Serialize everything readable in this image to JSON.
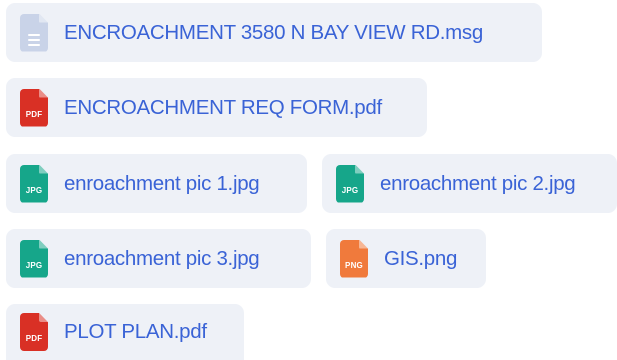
{
  "attachments": [
    {
      "name": "ENCROACHMENT 3580 N BAY VIEW RD.msg",
      "type_label": "",
      "icon": "document-icon",
      "color": "#c9d3e8"
    },
    {
      "name": "ENCROACHMENT REQ FORM.pdf",
      "type_label": "PDF",
      "icon": "pdf-file-icon",
      "color": "#d93025"
    },
    {
      "name": "enroachment pic 1.jpg",
      "type_label": "JPG",
      "icon": "jpg-file-icon",
      "color": "#16a68a"
    },
    {
      "name": "enroachment pic 2.jpg",
      "type_label": "JPG",
      "icon": "jpg-file-icon",
      "color": "#16a68a"
    },
    {
      "name": "enroachment pic 3.jpg",
      "type_label": "JPG",
      "icon": "jpg-file-icon",
      "color": "#16a68a"
    },
    {
      "name": "GIS.png",
      "type_label": "PNG",
      "icon": "png-file-icon",
      "color": "#f07a3c"
    },
    {
      "name": "PLOT PLAN.pdf",
      "type_label": "PDF",
      "icon": "pdf-file-icon",
      "color": "#d93025"
    }
  ],
  "colors": {
    "chip_background": "#eef1f7",
    "link_text": "#3a63d6"
  }
}
